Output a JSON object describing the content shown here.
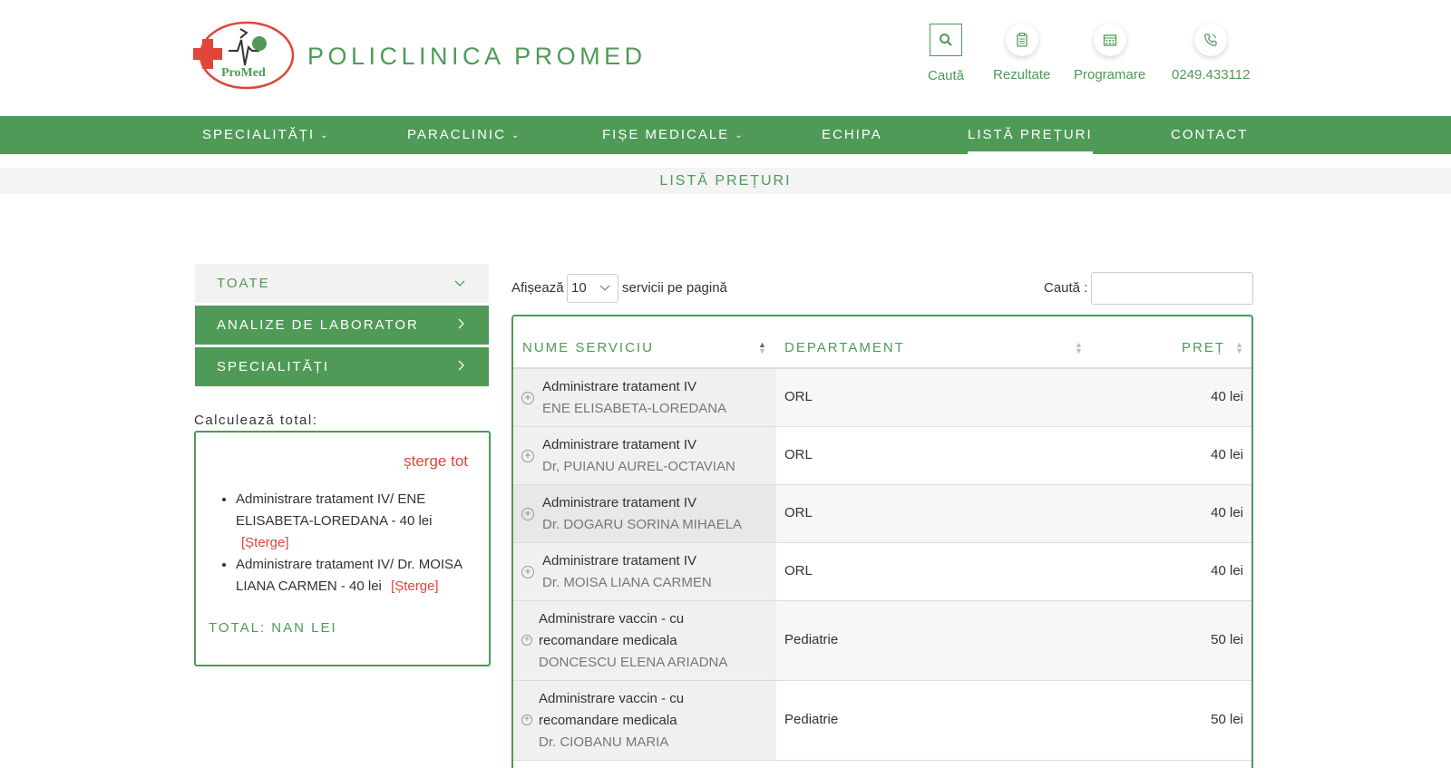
{
  "header": {
    "brand": "POLICLINICA PROMED",
    "logo_text": "ProMed",
    "actions": [
      {
        "label": "Caută",
        "icon": "search-icon"
      },
      {
        "label": "Rezultate",
        "icon": "document-icon"
      },
      {
        "label": "Programare",
        "icon": "calendar-icon"
      },
      {
        "label": "0249.433112",
        "icon": "phone-icon"
      }
    ]
  },
  "nav": {
    "items": [
      {
        "label": "SPECIALITĂȚI",
        "dropdown": true
      },
      {
        "label": "PARACLINIC",
        "dropdown": true
      },
      {
        "label": "FIȘE MEDICALE",
        "dropdown": true
      },
      {
        "label": "ECHIPA",
        "dropdown": false
      },
      {
        "label": "LISTĂ PREȚURI",
        "dropdown": false,
        "active": true
      },
      {
        "label": "CONTACT",
        "dropdown": false
      }
    ]
  },
  "page_title": "LISTĂ PREȚURI",
  "sidebar": {
    "filters": [
      {
        "label": "TOATE"
      },
      {
        "label": "ANALIZE DE LABORATOR"
      },
      {
        "label": "SPECIALITĂȚI"
      }
    ],
    "calc_label": "Calculează total:",
    "clear_all": "șterge tot",
    "items": [
      {
        "text": "Administrare tratament IV/ ENE ELISABETA-LOREDANA - 40 lei",
        "remove": "[Șterge]"
      },
      {
        "text": "Administrare tratament IV/ Dr. MOISA LIANA CARMEN - 40 lei",
        "remove": "[Șterge]"
      }
    ],
    "total": "TOTAL: NAN LEI"
  },
  "table_controls": {
    "show_label": "Afișează",
    "page_size": "10",
    "per_page_label": "servicii pe pagină",
    "search_label": "Caută :",
    "search_value": ""
  },
  "table": {
    "columns": [
      "NUME SERVICIU",
      "DEPARTAMENT",
      "PREȚ"
    ],
    "rows": [
      {
        "service": "Administrare tratament IV",
        "doctor": "ENE ELISABETA-LOREDANA",
        "department": "ORL",
        "price": "40 lei"
      },
      {
        "service": "Administrare tratament IV",
        "doctor": "Dr, PUIANU AUREL-OCTAVIAN",
        "department": "ORL",
        "price": "40 lei"
      },
      {
        "service": "Administrare tratament IV",
        "doctor": "Dr. DOGARU SORINA MIHAELA",
        "department": "ORL",
        "price": "40 lei"
      },
      {
        "service": "Administrare tratament IV",
        "doctor": "Dr. MOISA LIANA CARMEN",
        "department": "ORL",
        "price": "40 lei"
      },
      {
        "service_line1": "Administrare vaccin - cu",
        "service_line2": "recomandare medicala",
        "doctor": "DONCESCU ELENA ARIADNA",
        "department": "Pediatrie",
        "price": "50 lei"
      },
      {
        "service_line1": "Administrare vaccin - cu",
        "service_line2": "recomandare medicala",
        "doctor": "Dr. CIOBANU MARIA",
        "department": "Pediatrie",
        "price": "50 lei"
      }
    ]
  },
  "colors": {
    "brand_green": "#4f9a57",
    "danger_red": "#e0453a"
  }
}
